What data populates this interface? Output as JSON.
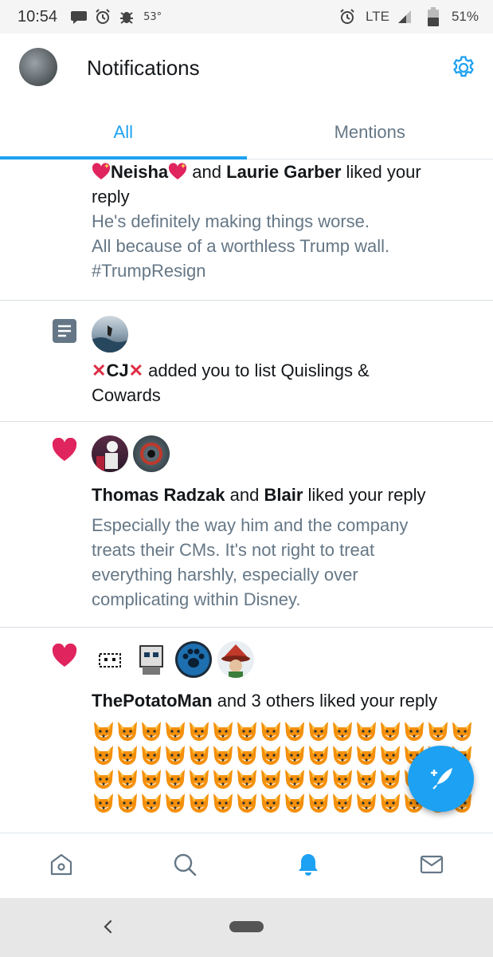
{
  "status_bar": {
    "time": "10:54",
    "temperature": "53°",
    "network": "LTE",
    "battery": "51%",
    "icons": [
      "message-icon",
      "alarm-icon",
      "bug-icon",
      "alarm-icon",
      "signal-icon",
      "battery-icon"
    ]
  },
  "header": {
    "title": "Notifications",
    "settings_icon": "gear-icon"
  },
  "tabs": [
    {
      "label": "All",
      "active": true
    },
    {
      "label": "Mentions",
      "active": false
    }
  ],
  "notifications": [
    {
      "type": "like",
      "line1_user1": "Neisha",
      "line1_connector": "and",
      "line1_user2": "Laurie Garber",
      "line1_action": "liked your",
      "line2": "reply",
      "preview": [
        "He's definitely making things worse.",
        "All because of a worthless Trump wall.",
        "#TrumpResign"
      ]
    },
    {
      "type": "list",
      "icon": "list-icon",
      "user": "CJ",
      "action": "added you to list Quislings &",
      "action_line2": "Cowards"
    },
    {
      "type": "like",
      "icon": "heart-icon",
      "user1": "Thomas Radzak",
      "connector": "and",
      "user2": "Blair",
      "action": "liked your reply",
      "preview": [
        "Especially the way him and the company",
        "treats their CMs. It's not right to treat",
        "everything harshly, especially over",
        "complicating within Disney."
      ]
    },
    {
      "type": "like",
      "icon": "heart-icon",
      "user1": "ThePotatoMan",
      "action": "and 3 others liked your reply",
      "preview_emoji": "fox-face-emoji",
      "preview_emoji_count": 64
    }
  ],
  "fab": {
    "icon": "compose-tweet-icon"
  },
  "bottom_nav": [
    {
      "name": "home-icon",
      "active": false
    },
    {
      "name": "search-icon",
      "active": false
    },
    {
      "name": "notifications-bell-icon",
      "active": true
    },
    {
      "name": "messages-envelope-icon",
      "active": false
    }
  ],
  "colors": {
    "accent": "#1da1f2",
    "heart": "#e0245e",
    "text_secondary": "#657786"
  }
}
